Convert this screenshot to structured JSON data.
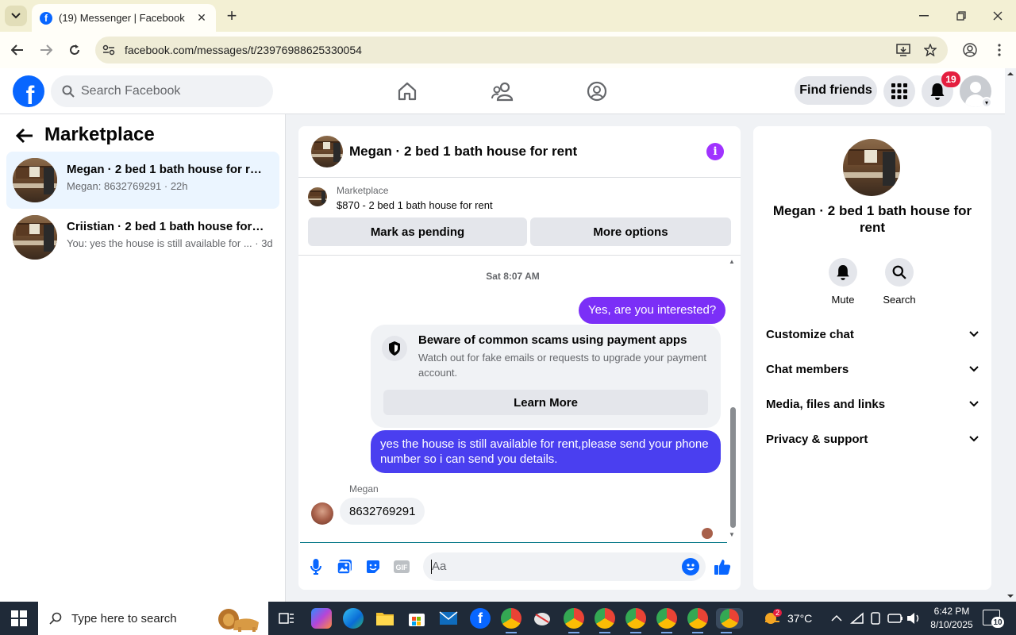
{
  "browser": {
    "tab_title": "(19) Messenger | Facebook",
    "url": "facebook.com/messages/t/23976988625330054",
    "tab_close": "✕",
    "new_tab": "+"
  },
  "header": {
    "search_placeholder": "Search Facebook",
    "find_friends_label": "Find friends",
    "notification_count": "19"
  },
  "sidebar": {
    "title": "Marketplace",
    "conversations": [
      {
        "name": "Megan · 2 bed 1 bath house for rent",
        "preview": "Megan: 8632769291 · 22h"
      },
      {
        "name": "Criistian · 2 bed 1 bath house for r...",
        "preview": "You: yes the house is still available for ... · 3d"
      }
    ]
  },
  "chat": {
    "title": "Megan · 2 bed 1 bath house for rent",
    "marketplace_label": "Marketplace",
    "listing": "$870 - 2 bed 1 bath house for rent",
    "mark_pending_label": "Mark as pending",
    "more_options_label": "More options",
    "timestamp": "Sat 8:07 AM",
    "messages": {
      "out_1": "Yes, are you interested?",
      "scam_title": "Beware of common scams using payment apps",
      "scam_body": "Watch out for fake emails or requests to upgrade your payment account.",
      "learn_more": "Learn More",
      "out_2": "yes the house is still available for rent,please send your phone number so i can send you details.",
      "in_sender": "Megan",
      "in_1": "8632769291"
    },
    "composer_placeholder": "Aa"
  },
  "details": {
    "name": "Megan · 2 bed 1 bath house for rent",
    "actions": [
      {
        "label": "Mute",
        "icon": "bell-icon"
      },
      {
        "label": "Search",
        "icon": "search-icon"
      }
    ],
    "sections": [
      "Customize chat",
      "Chat members",
      "Media, files and links",
      "Privacy & support"
    ]
  },
  "taskbar": {
    "search_placeholder": "Type here to search",
    "weather": "37°C",
    "weather_badge": "2",
    "time": "6:42 PM",
    "date": "8/10/2025",
    "notification_count": "10"
  },
  "colors": {
    "accent_purple": "#7b2ff7",
    "facebook_blue": "#0866ff",
    "badge_red": "#e41e3f"
  }
}
